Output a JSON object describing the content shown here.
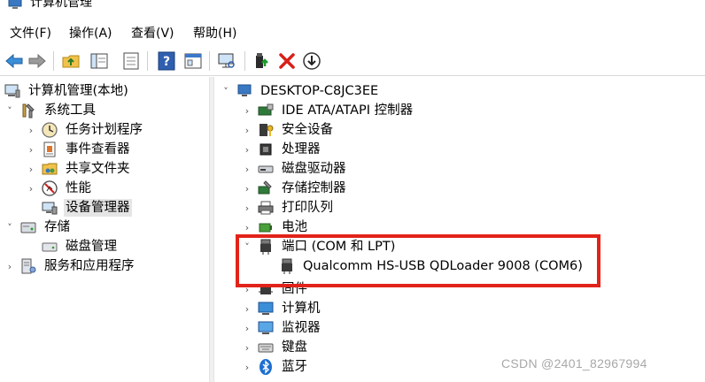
{
  "window": {
    "title": "计算机管理"
  },
  "menu": [
    {
      "label": "文件(F)"
    },
    {
      "label": "操作(A)"
    },
    {
      "label": "查看(V)"
    },
    {
      "label": "帮助(H)"
    }
  ],
  "toolbar": {
    "icons": [
      "back-icon",
      "forward-icon",
      "up-folder-icon",
      "show-hide-tree-icon",
      "export-list-icon",
      "help-icon",
      "properties-icon",
      "scan-hardware-icon",
      "update-driver-icon",
      "uninstall-icon",
      "disable-device-icon"
    ]
  },
  "left_tree": [
    {
      "label": "计算机管理(本地)",
      "expander": ""
    },
    {
      "label": "系统工具",
      "expander": "˅"
    },
    {
      "label": "任务计划程序",
      "expander": "›"
    },
    {
      "label": "事件查看器",
      "expander": "›"
    },
    {
      "label": "共享文件夹",
      "expander": "›"
    },
    {
      "label": "性能",
      "expander": "›"
    },
    {
      "label": "设备管理器",
      "expander": "",
      "selected": true
    },
    {
      "label": "存储",
      "expander": "˅"
    },
    {
      "label": "磁盘管理",
      "expander": ""
    },
    {
      "label": "服务和应用程序",
      "expander": "›"
    }
  ],
  "device_tree": [
    {
      "label": "DESKTOP-C8JC3EE",
      "expander": "˅"
    },
    {
      "label": "IDE ATA/ATAPI 控制器",
      "expander": "›"
    },
    {
      "label": "安全设备",
      "expander": "›"
    },
    {
      "label": "处理器",
      "expander": "›"
    },
    {
      "label": "磁盘驱动器",
      "expander": "›"
    },
    {
      "label": "存储控制器",
      "expander": "›"
    },
    {
      "label": "打印队列",
      "expander": "›"
    },
    {
      "label": "电池",
      "expander": "›"
    },
    {
      "label": "端口 (COM 和 LPT)",
      "expander": "˅"
    },
    {
      "label": "Qualcomm HS-USB QDLoader 9008 (COM6)",
      "expander": ""
    },
    {
      "label": "固件",
      "expander": "›"
    },
    {
      "label": "计算机",
      "expander": "›"
    },
    {
      "label": "监视器",
      "expander": "›"
    },
    {
      "label": "键盘",
      "expander": "›"
    },
    {
      "label": "蓝牙",
      "expander": "›"
    }
  ],
  "colors": {
    "highlight": "#e2231a",
    "selection": "#e5e5e5"
  },
  "watermark": "CSDN @2401_82967994"
}
